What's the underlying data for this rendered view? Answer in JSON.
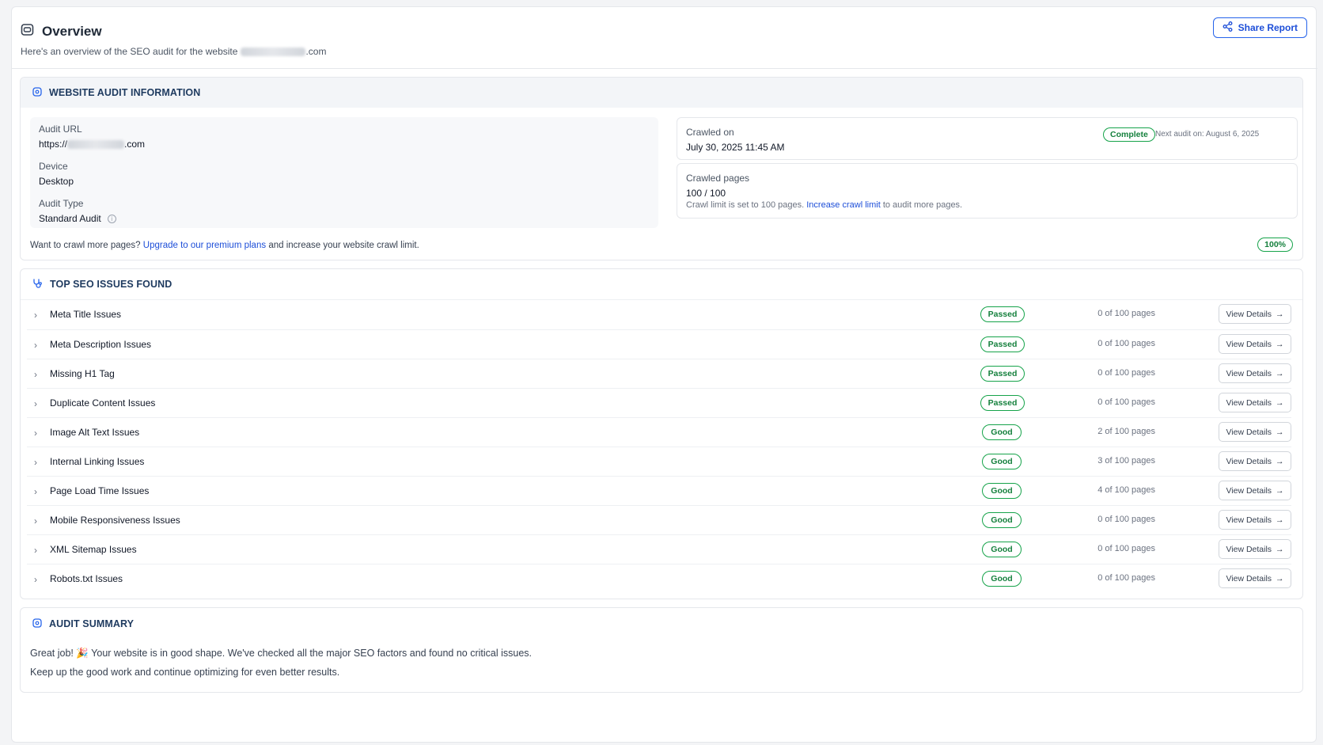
{
  "header": {
    "title": "Overview",
    "subtitle_prefix": "Here's an overview of the SEO audit for the website",
    "subtitle_domain_suffix": ".com",
    "share_label": "Share Report"
  },
  "audit_info": {
    "heading": "WEBSITE AUDIT INFORMATION",
    "audit_url_label": "Audit URL",
    "audit_url_prefix": "https://",
    "audit_url_suffix": ".com",
    "device_label": "Device",
    "device_value": "Desktop",
    "audit_type_label": "Audit Type",
    "audit_type_value": "Standard Audit",
    "crawled_on_label": "Crawled on",
    "crawled_on_value": "July 30, 2025 11:45 AM",
    "status": "Complete",
    "next_audit": "Next audit on: August 6, 2025",
    "crawled_pages_label": "Crawled pages",
    "crawled_pages_value": "100 / 100",
    "crawl_limit_prefix": "Crawl limit is set to 100 pages.",
    "crawl_limit_link": "Increase crawl limit",
    "crawl_limit_suffix": "to audit more pages.",
    "crawl_more_prefix": "Want to crawl more pages?",
    "crawl_more_link": "Upgrade to our premium plans",
    "crawl_more_suffix": "and increase your website crawl limit.",
    "progress": "100%"
  },
  "issues": {
    "heading": "TOP SEO ISSUES FOUND",
    "view_label": "View Details",
    "rows": [
      {
        "name": "Meta Title Issues",
        "status": "Passed",
        "count": "0 of 100 pages"
      },
      {
        "name": "Meta Description Issues",
        "status": "Passed",
        "count": "0 of 100 pages"
      },
      {
        "name": "Missing H1 Tag",
        "status": "Passed",
        "count": "0 of 100 pages"
      },
      {
        "name": "Duplicate Content Issues",
        "status": "Passed",
        "count": "0 of 100 pages"
      },
      {
        "name": "Image Alt Text Issues",
        "status": "Good",
        "count": "2 of 100 pages"
      },
      {
        "name": "Internal Linking Issues",
        "status": "Good",
        "count": "3 of 100 pages"
      },
      {
        "name": "Page Load Time Issues",
        "status": "Good",
        "count": "4 of 100 pages"
      },
      {
        "name": "Mobile Responsiveness Issues",
        "status": "Good",
        "count": "0 of 100 pages"
      },
      {
        "name": "XML Sitemap Issues",
        "status": "Good",
        "count": "0 of 100 pages"
      },
      {
        "name": "Robots.txt Issues",
        "status": "Good",
        "count": "0 of 100 pages"
      }
    ]
  },
  "summary": {
    "heading": "AUDIT SUMMARY",
    "line1": "Great job! 🎉 Your website is in good shape. We've checked all the major SEO factors and found no critical issues.",
    "line2": "Keep up the good work and continue optimizing for even better results."
  },
  "colors": {
    "accent": "#1d4ed8",
    "success": "#16a34a",
    "heading": "#1e3a5f"
  }
}
